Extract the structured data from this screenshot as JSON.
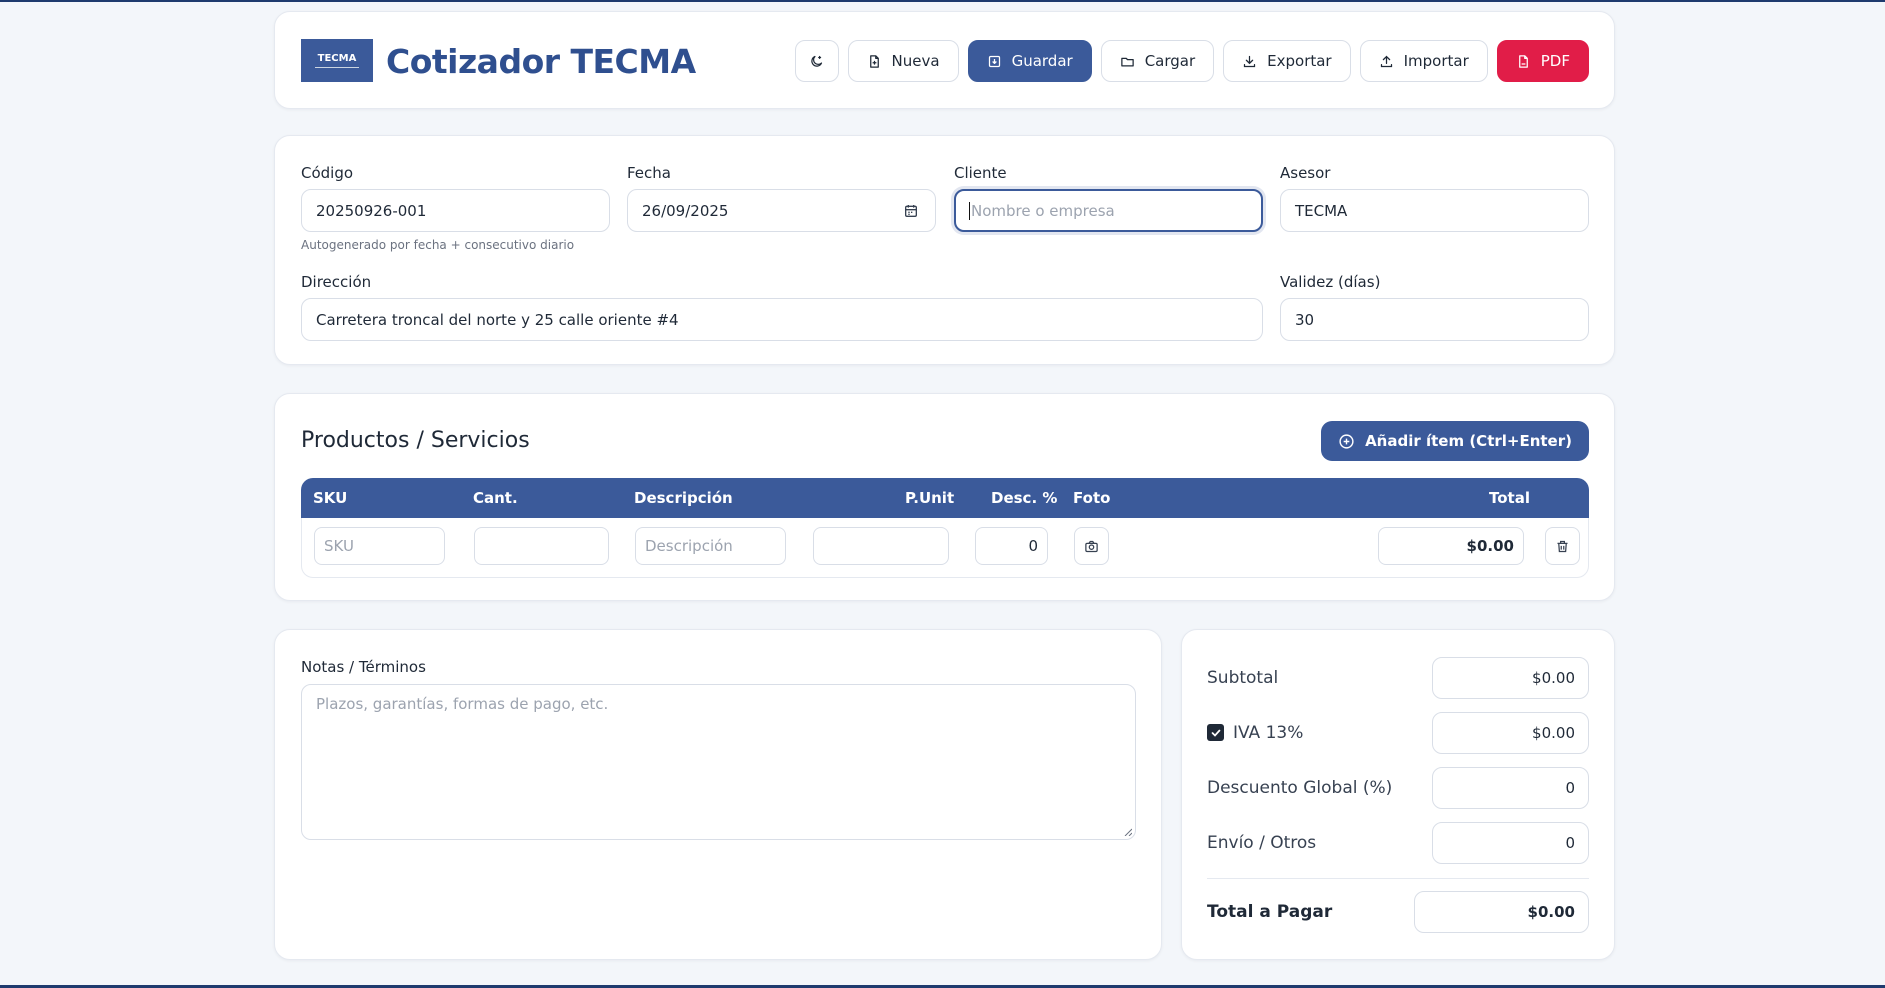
{
  "app": {
    "title": "Cotizador TECMA",
    "logo_text": "TECMA"
  },
  "toolbar": {
    "theme_icon": "moon-icon",
    "nueva": "Nueva",
    "guardar": "Guardar",
    "cargar": "Cargar",
    "exportar": "Exportar",
    "importar": "Importar",
    "pdf": "PDF"
  },
  "form": {
    "codigo_label": "Código",
    "codigo_value": "20250926-001",
    "codigo_hint": "Autogenerado por fecha + consecutivo diario",
    "fecha_label": "Fecha",
    "fecha_value": "26/09/2025",
    "cliente_label": "Cliente",
    "cliente_placeholder": "Nombre o empresa",
    "asesor_label": "Asesor",
    "asesor_value": "TECMA",
    "direccion_label": "Dirección",
    "direccion_value": "Carretera troncal del norte y 25 calle oriente #4",
    "validez_label": "Validez (días)",
    "validez_value": "30"
  },
  "products": {
    "title": "Productos / Servicios",
    "add_button": "Añadir ítem (Ctrl+Enter)",
    "columns": [
      "SKU",
      "Cant.",
      "Descripción",
      "P.Unit",
      "Desc. %",
      "Foto",
      "Total"
    ],
    "row": {
      "sku_placeholder": "SKU",
      "cant": "",
      "desc_placeholder": "Descripción",
      "punit": "",
      "desc_pct": "0",
      "total": "$0.00"
    }
  },
  "notes": {
    "label": "Notas / Términos",
    "placeholder": "Plazos, garantías, formas de pago, etc."
  },
  "totals": {
    "subtotal_label": "Subtotal",
    "subtotal_value": "$0.00",
    "iva_label": "IVA 13%",
    "iva_checked": true,
    "iva_value": "$0.00",
    "descuento_label": "Descuento Global (%)",
    "descuento_value": "0",
    "envio_label": "Envío / Otros",
    "envio_value": "0",
    "total_label": "Total a Pagar",
    "total_value": "$0.00"
  },
  "colors": {
    "primary": "#3b5a9a",
    "danger": "#e11d48",
    "background": "#f3f6fa"
  }
}
